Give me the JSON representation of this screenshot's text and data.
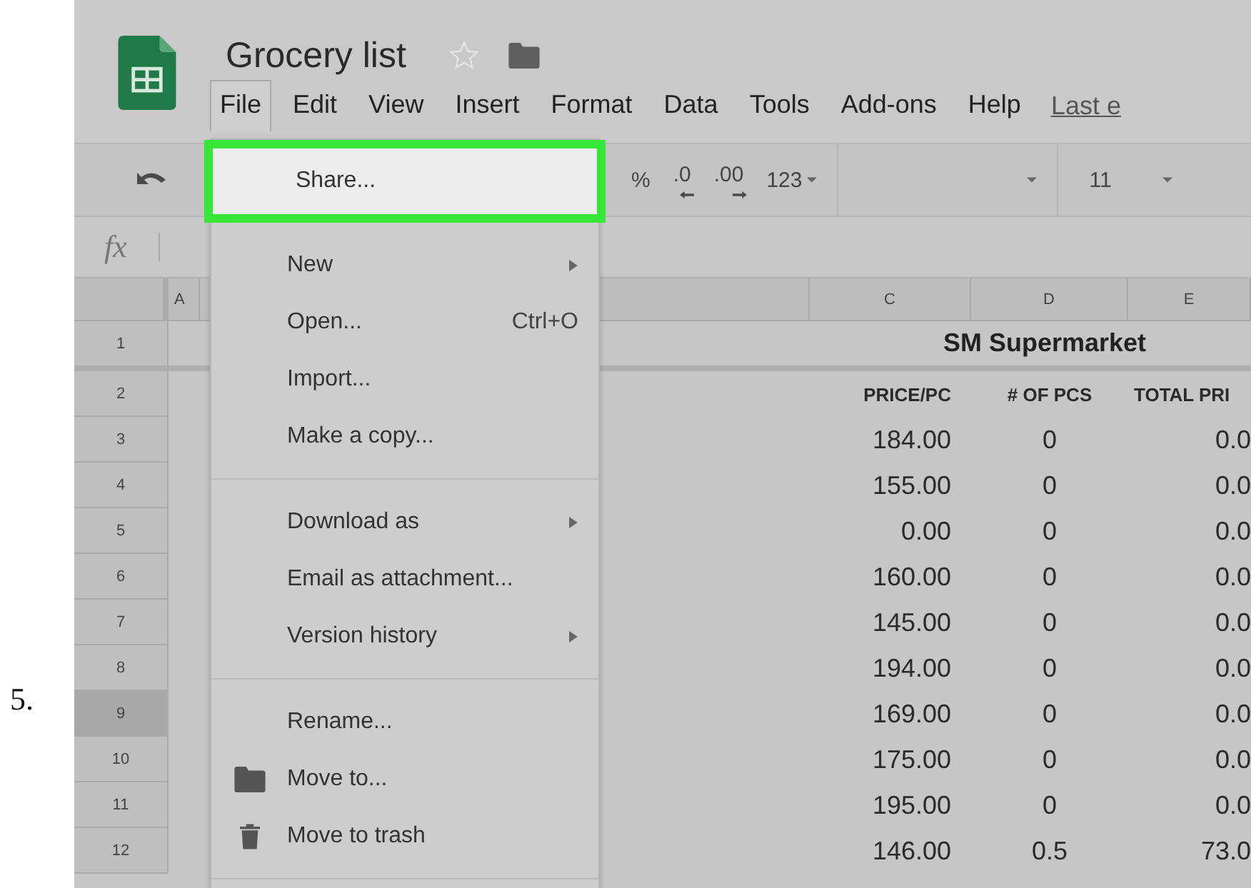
{
  "step_number": "5.",
  "app": {
    "title": "Grocery list",
    "starred": false,
    "menu_bar": [
      {
        "label": "File",
        "selected": true
      },
      {
        "label": "Edit",
        "selected": false
      },
      {
        "label": "View",
        "selected": false
      },
      {
        "label": "Insert",
        "selected": false
      },
      {
        "label": "Format",
        "selected": false
      },
      {
        "label": "Data",
        "selected": false
      },
      {
        "label": "Tools",
        "selected": false
      },
      {
        "label": "Add-ons",
        "selected": false
      },
      {
        "label": "Help",
        "selected": false
      }
    ],
    "last_edit_link": "Last e"
  },
  "toolbar": {
    "percent": "%",
    "decrease_decimals": ".0",
    "increase_decimals": ".00",
    "number_format": "123",
    "font_size": "11"
  },
  "formula_bar": {
    "label": "fx"
  },
  "sheet": {
    "columns": [
      "A",
      "C",
      "D",
      "E"
    ],
    "title_row": {
      "number": "1",
      "selected": false,
      "text": "SM Supermarket"
    },
    "header_row": {
      "number": "2",
      "selected": false,
      "cells": [
        "PRICE/PC",
        "# OF PCS",
        "TOTAL PRI"
      ]
    },
    "rows": [
      {
        "number": "3",
        "selected": false,
        "price": "184.00",
        "count": "0",
        "total": "0.0"
      },
      {
        "number": "4",
        "selected": false,
        "price": "155.00",
        "count": "0",
        "total": "0.0"
      },
      {
        "number": "5",
        "selected": false,
        "price": "0.00",
        "count": "0",
        "total": "0.0"
      },
      {
        "number": "6",
        "selected": false,
        "price": "160.00",
        "count": "0",
        "total": "0.0"
      },
      {
        "number": "7",
        "selected": false,
        "price": "145.00",
        "count": "0",
        "total": "0.0"
      },
      {
        "number": "8",
        "selected": false,
        "price": "194.00",
        "count": "0",
        "total": "0.0"
      },
      {
        "number": "9",
        "selected": true,
        "price": "169.00",
        "count": "0",
        "total": "0.0"
      },
      {
        "number": "10",
        "selected": false,
        "price": "175.00",
        "count": "0",
        "total": "0.0"
      },
      {
        "number": "11",
        "selected": false,
        "price": "195.00",
        "count": "0",
        "total": "0.0"
      },
      {
        "number": "12",
        "selected": false,
        "price": "146.00",
        "count": "0.5",
        "total": "73.0"
      }
    ]
  },
  "file_menu": [
    {
      "kind": "item",
      "label": "Share...",
      "selected": true
    },
    {
      "kind": "item",
      "label": "New",
      "selected": false,
      "submenu": true
    },
    {
      "kind": "item",
      "label": "Open...",
      "selected": false,
      "shortcut": "Ctrl+O"
    },
    {
      "kind": "item",
      "label": "Import...",
      "selected": false
    },
    {
      "kind": "item",
      "label": "Make a copy...",
      "selected": false
    },
    {
      "kind": "separator"
    },
    {
      "kind": "item",
      "label": "Download as",
      "selected": false,
      "submenu": true
    },
    {
      "kind": "item",
      "label": "Email as attachment...",
      "selected": false
    },
    {
      "kind": "item",
      "label": "Version history",
      "selected": false,
      "submenu": true
    },
    {
      "kind": "separator"
    },
    {
      "kind": "item",
      "label": "Rename...",
      "selected": false
    },
    {
      "kind": "folder-item",
      "label": "Move to...",
      "selected": false
    },
    {
      "kind": "trash-item",
      "label": "Move to trash",
      "selected": false
    },
    {
      "kind": "separator"
    }
  ]
}
